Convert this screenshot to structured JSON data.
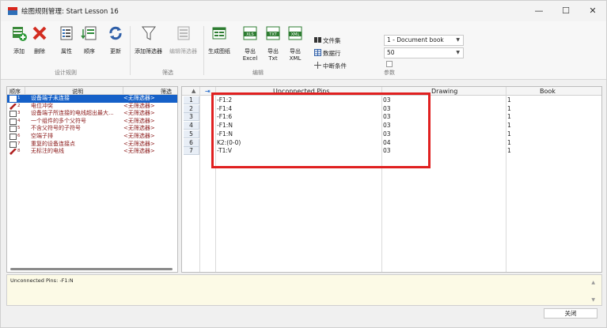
{
  "window": {
    "title": "绘图规则管理: Start Lesson 16"
  },
  "ribbon": {
    "groups": {
      "design_rules": "设计规则",
      "filter": "筛选",
      "report": "编辑",
      "params": "参数"
    },
    "tools": {
      "add": "添加",
      "delete": "删除",
      "properties": "属性",
      "order": "顺序",
      "refresh": "更新",
      "add_filter": "添加筛选器",
      "edit_filter": "编辑筛选器",
      "gen_drawing": "生成图纸",
      "export_excel_1": "导出",
      "export_excel_2": "Excel",
      "export_txt_1": "导出",
      "export_txt_2": "Txt",
      "export_xml_1": "导出",
      "export_xml_2": "XML"
    },
    "side": {
      "file_set": "文件集",
      "data_rows": "数据行",
      "break_condition": "中断条件"
    },
    "combo_doc": "1 - Document book",
    "combo_num": "50"
  },
  "rules": {
    "headers": {
      "order": "顺序",
      "desc": "说明",
      "filter": "筛选"
    },
    "items": [
      {
        "n": "1",
        "desc": "设备端子未连接",
        "filter": "<无筛选器>"
      },
      {
        "n": "2",
        "desc": "电位冲突",
        "filter": "<无筛选器>"
      },
      {
        "n": "3",
        "desc": "设备端子所连接的电线超出最大...",
        "filter": "<无筛选器>"
      },
      {
        "n": "4",
        "desc": "一个组件的多个父符号",
        "filter": "<无筛选器>"
      },
      {
        "n": "5",
        "desc": "不含父符号的子符号",
        "filter": "<无筛选器>"
      },
      {
        "n": "6",
        "desc": "空端子排",
        "filter": "<无筛选器>"
      },
      {
        "n": "7",
        "desc": "重复的设备连接点",
        "filter": "<无筛选器>"
      },
      {
        "n": "8",
        "desc": "无标注的电线",
        "filter": "<无筛选器>"
      }
    ]
  },
  "grid": {
    "headers": {
      "sort": "▲",
      "pin": "⇥",
      "pins": "Unconnected Pins",
      "drawing": "Drawing",
      "book": "Book"
    },
    "rows": [
      {
        "n": "1",
        "pin": "-F1:2",
        "drawing": "03",
        "book": "1"
      },
      {
        "n": "2",
        "pin": "-F1:4",
        "drawing": "03",
        "book": "1"
      },
      {
        "n": "3",
        "pin": "-F1:6",
        "drawing": "03",
        "book": "1"
      },
      {
        "n": "4",
        "pin": "-F1:N",
        "drawing": "03",
        "book": "1"
      },
      {
        "n": "5",
        "pin": "-F1:N",
        "drawing": "03",
        "book": "1"
      },
      {
        "n": "6",
        "pin": "K2:(0-0)",
        "drawing": "04",
        "book": "1"
      },
      {
        "n": "7",
        "pin": "-T1:V",
        "drawing": "03",
        "book": "1"
      }
    ]
  },
  "message": "Unconnected Pins: -F1:N",
  "close_label": "关闭",
  "colors": {
    "selection": "#1560c8",
    "highlight": "#e02020",
    "message_bg": "#fcfae6"
  }
}
